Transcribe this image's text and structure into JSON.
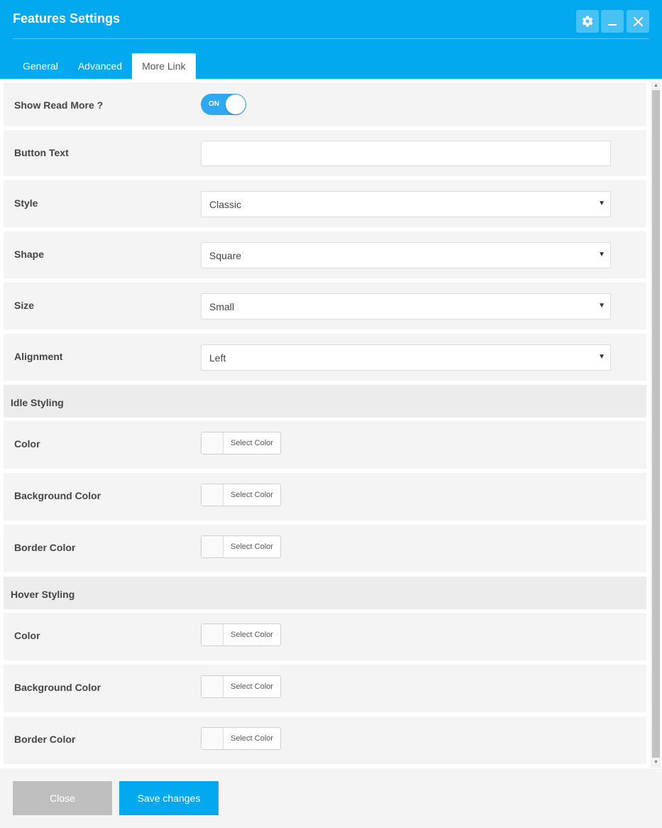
{
  "window": {
    "title": "Features Settings",
    "accent_color": "#03a9ee"
  },
  "header_buttons": {
    "settings_icon": "gear-icon",
    "minimize_icon": "minimize-icon",
    "close_icon": "close-icon"
  },
  "tabs": [
    {
      "label": "General",
      "active": false
    },
    {
      "label": "Advanced",
      "active": false
    },
    {
      "label": "More Link",
      "active": true
    }
  ],
  "fields": {
    "show_read_more": {
      "label": "Show Read More ?",
      "toggle_text": "ON",
      "enabled": true
    },
    "button_text": {
      "label": "Button Text",
      "value": ""
    },
    "style": {
      "label": "Style",
      "value": "Classic"
    },
    "shape": {
      "label": "Shape",
      "value": "Square"
    },
    "size": {
      "label": "Size",
      "value": "Small"
    },
    "alignment": {
      "label": "Alignment",
      "value": "Left"
    }
  },
  "idle_styling": {
    "title": "Idle Styling",
    "color": {
      "label": "Color",
      "button": "Select Color"
    },
    "background_color": {
      "label": "Background Color",
      "button": "Select Color"
    },
    "border_color": {
      "label": "Border Color",
      "button": "Select Color"
    }
  },
  "hover_styling": {
    "title": "Hover Styling",
    "color": {
      "label": "Color",
      "button": "Select Color"
    },
    "background_color": {
      "label": "Background Color",
      "button": "Select Color"
    },
    "border_color": {
      "label": "Border Color",
      "button": "Select Color"
    }
  },
  "footer": {
    "close_label": "Close",
    "save_label": "Save changes"
  }
}
